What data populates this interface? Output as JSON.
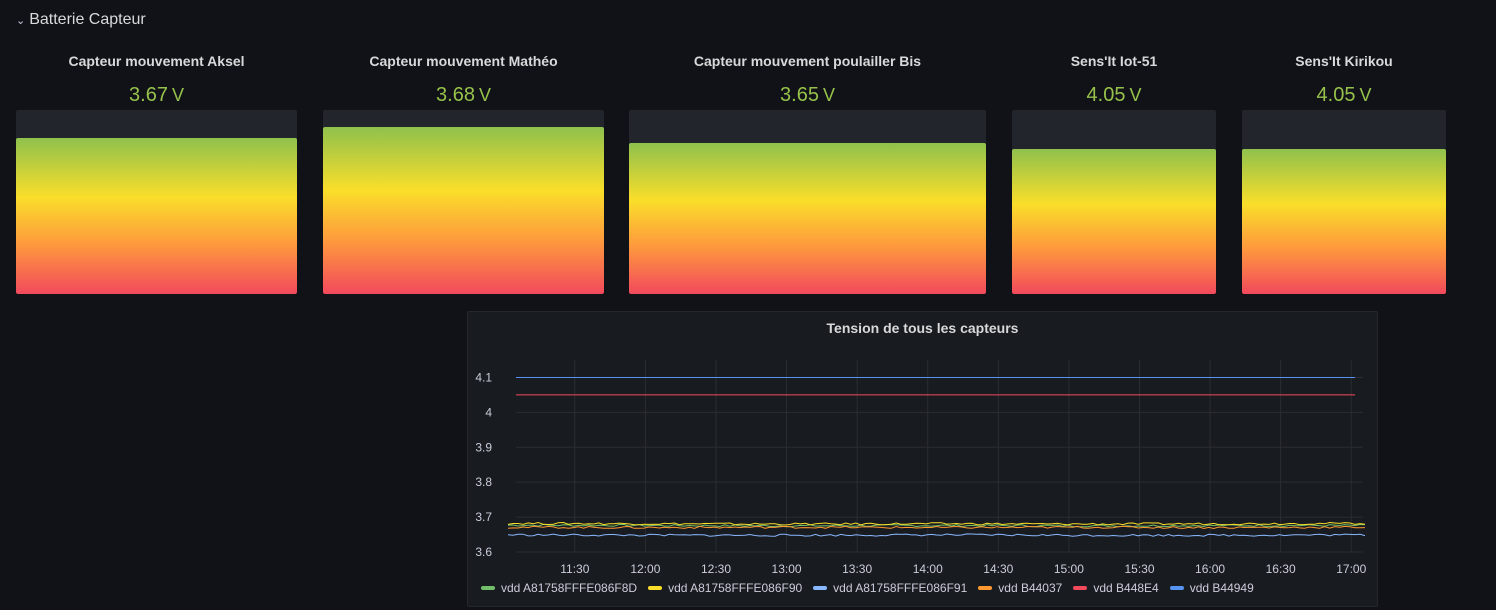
{
  "row": {
    "title": "Batterie Capteur"
  },
  "gauges": [
    {
      "title": "Capteur mouvement Aksel",
      "value": "3.67",
      "unit": "V",
      "level": 0.85
    },
    {
      "title": "Capteur mouvement Mathéo",
      "value": "3.68",
      "unit": "V",
      "level": 0.91
    },
    {
      "title": "Capteur mouvement poulailler Bis",
      "value": "3.65",
      "unit": "V",
      "level": 0.82
    },
    {
      "title": "Sens'It Iot-51",
      "value": "4.05",
      "unit": "V",
      "level": 0.79
    },
    {
      "title": "Sens'It Kirikou",
      "value": "4.05",
      "unit": "V",
      "level": 0.79
    }
  ],
  "timeseries": {
    "title": "Tension de tous les capteurs"
  },
  "colors": {
    "value_green": "#96c24b",
    "panel_bg": "#181b1f",
    "page_bg": "#111217"
  },
  "chart_data": {
    "type": "line",
    "title": "Tension de tous les capteurs",
    "xlabel": "",
    "ylabel": "",
    "x_ticks": [
      "11:30",
      "12:00",
      "12:30",
      "13:00",
      "13:30",
      "14:00",
      "14:30",
      "15:00",
      "15:30",
      "16:00",
      "16:30",
      "17:00"
    ],
    "y_ticks": [
      "3.6",
      "3.7",
      "3.8",
      "3.9",
      "4",
      "4.1"
    ],
    "xlim": [
      "11:05",
      "17:05"
    ],
    "ylim": [
      3.6,
      4.15
    ],
    "grid": true,
    "legend": "bottom",
    "series": [
      {
        "name": "vdd A81758FFFE086F8D",
        "color": "#73bf69",
        "x": [
          "11:05",
          "12:00",
          "13:00",
          "14:00",
          "15:00",
          "16:00",
          "17:05"
        ],
        "values": [
          3.677,
          3.676,
          3.675,
          3.676,
          3.675,
          3.676,
          3.676
        ]
      },
      {
        "name": "vdd A81758FFFE086F90",
        "color": "#fade2a",
        "x": [
          "11:05",
          "12:00",
          "13:00",
          "14:00",
          "15:00",
          "16:00",
          "17:05"
        ],
        "values": [
          3.682,
          3.681,
          3.68,
          3.681,
          3.68,
          3.681,
          3.682
        ]
      },
      {
        "name": "vdd A81758FFFE086F91",
        "color": "#8ab8ff",
        "x": [
          "11:05",
          "12:00",
          "13:00",
          "14:00",
          "15:00",
          "16:00",
          "17:05"
        ],
        "values": [
          3.649,
          3.648,
          3.648,
          3.649,
          3.648,
          3.648,
          3.649
        ]
      },
      {
        "name": "vdd B44037",
        "color": "#ff9830",
        "x": [
          "11:05",
          "12:00",
          "13:00",
          "14:00",
          "15:00",
          "16:00",
          "17:05"
        ],
        "values": [
          3.671,
          3.67,
          3.671,
          3.67,
          3.671,
          3.67,
          3.671
        ]
      },
      {
        "name": "vdd B448E4",
        "color": "#f2495c",
        "x": [
          "11:05",
          "17:05"
        ],
        "values": [
          4.05,
          4.05
        ]
      },
      {
        "name": "vdd B44949",
        "color": "#5794f2",
        "x": [
          "11:05",
          "17:05"
        ],
        "values": [
          4.1,
          4.1
        ]
      }
    ]
  }
}
